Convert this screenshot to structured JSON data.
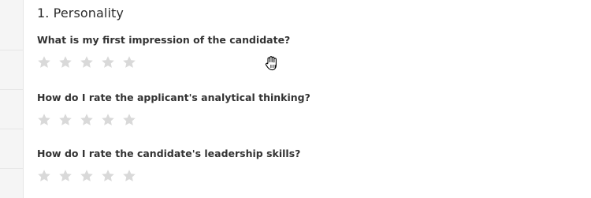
{
  "section": {
    "title": "1. Personality"
  },
  "questions": [
    {
      "text": "What is my first impression of the candidate?",
      "rating": 0,
      "max": 5
    },
    {
      "text": "How do I rate the applicant's analytical thinking?",
      "rating": 0,
      "max": 5
    },
    {
      "text": "How do I rate the candidate's leadership skills?",
      "rating": 0,
      "max": 5
    }
  ],
  "colors": {
    "star_empty": "#d9d9d9",
    "text": "#333333"
  },
  "icons": {
    "rating_star": "star-icon",
    "pointer": "hand-cursor-icon"
  }
}
